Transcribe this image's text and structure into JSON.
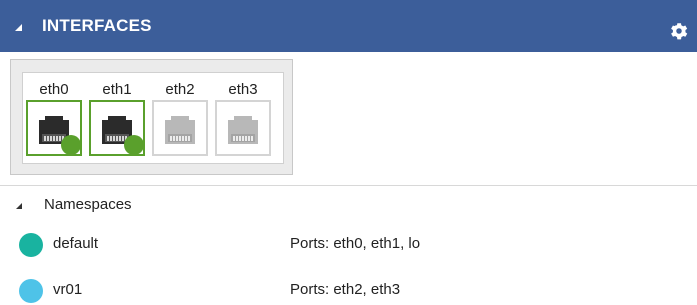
{
  "header": {
    "title": "INTERFACES",
    "background": "#3c5e9a",
    "collapse_icon": "triangle-expanded-icon",
    "settings_icon": "gear-icon"
  },
  "ports": [
    {
      "label": "eth0",
      "active": true
    },
    {
      "label": "eth1",
      "active": true
    },
    {
      "label": "eth2",
      "active": false
    },
    {
      "label": "eth3",
      "active": false
    }
  ],
  "colors": {
    "active_port": "#5aa02c",
    "inactive_port": "#b8b8b8",
    "namespace_default": "#19b3a0",
    "namespace_vr01": "#4ec3e8"
  },
  "namespaces": {
    "title": "Namespaces",
    "items": [
      {
        "name": "default",
        "ports": "Ports:  eth0, eth1, lo",
        "color": "#19b3a0"
      },
      {
        "name": "vr01",
        "ports": "Ports:  eth2, eth3",
        "color": "#4ec3e8"
      }
    ]
  }
}
